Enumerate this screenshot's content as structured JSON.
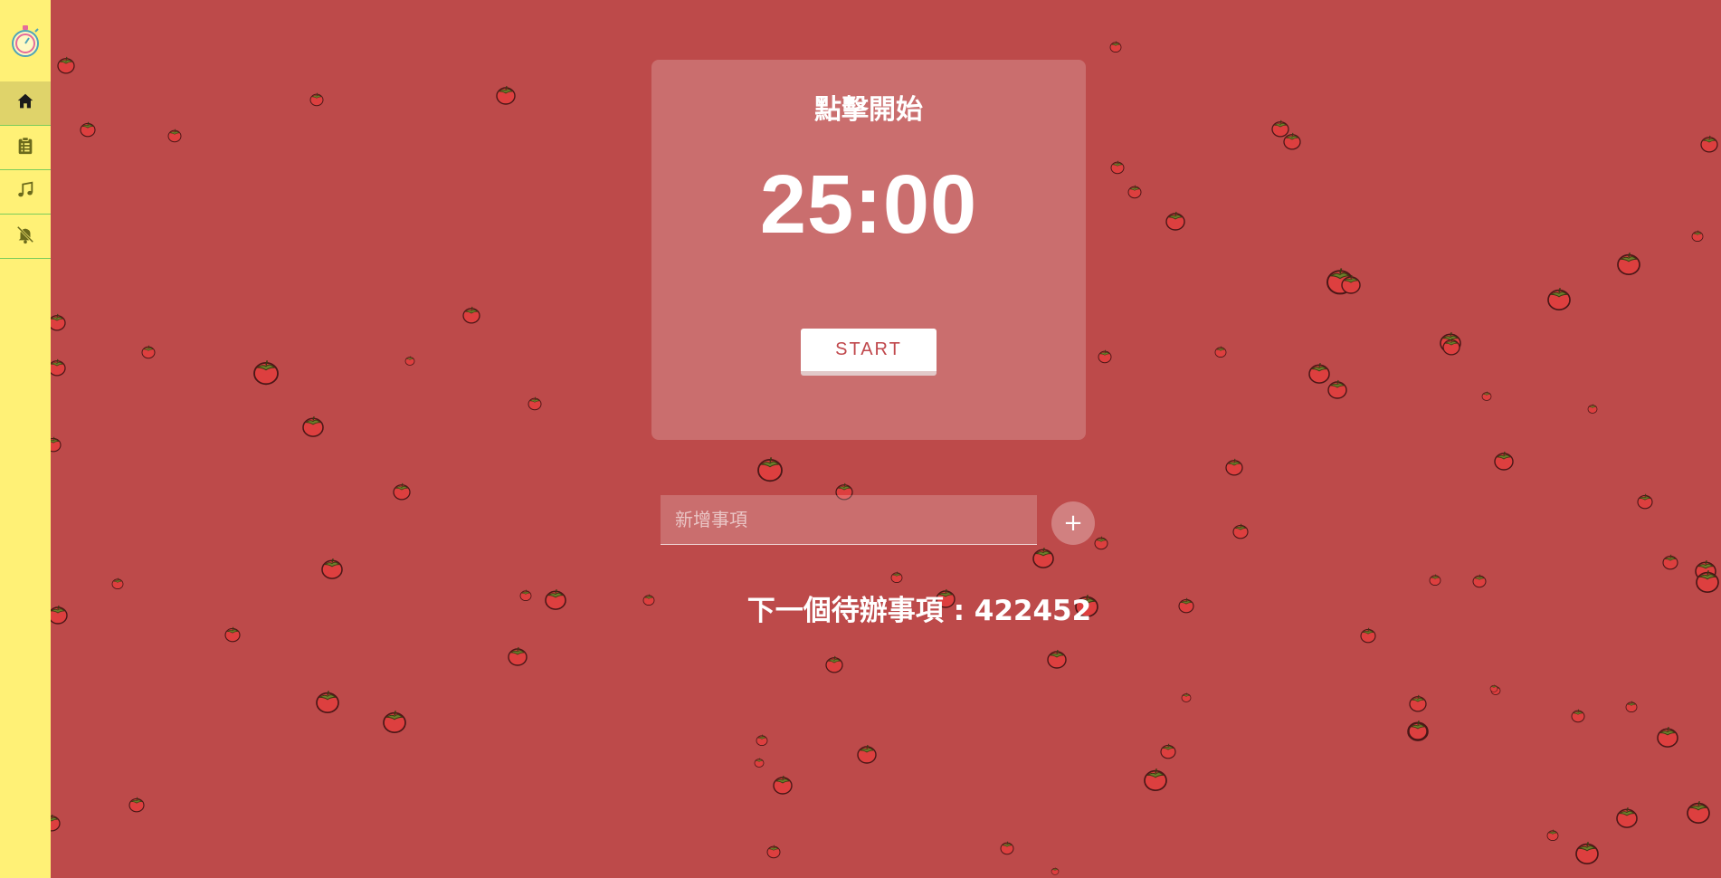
{
  "nav": {
    "logo_icon": "stopwatch-logo-icon",
    "items": [
      {
        "name": "home",
        "icon": "home-icon",
        "active": true
      },
      {
        "name": "todo-list",
        "icon": "clipboard-list-icon",
        "active": false
      },
      {
        "name": "music",
        "icon": "music-note-icon",
        "active": false
      },
      {
        "name": "notifications-off",
        "icon": "bell-off-icon",
        "active": false
      }
    ]
  },
  "timer": {
    "title": "點擊開始",
    "time": "25:00",
    "start_label": "START"
  },
  "todo": {
    "placeholder": "新增事項",
    "add_label": "+",
    "next_label": "下一個待辦事項 : ",
    "next_value": "422452"
  },
  "colors": {
    "background": "#bd4a4a",
    "sidebar": "#fff176",
    "sidebar_active": "#dfd36a",
    "sidebar_divider": "#7ccd5c",
    "accent_text": "#c0484c",
    "tomato": "#dd3f3f"
  }
}
